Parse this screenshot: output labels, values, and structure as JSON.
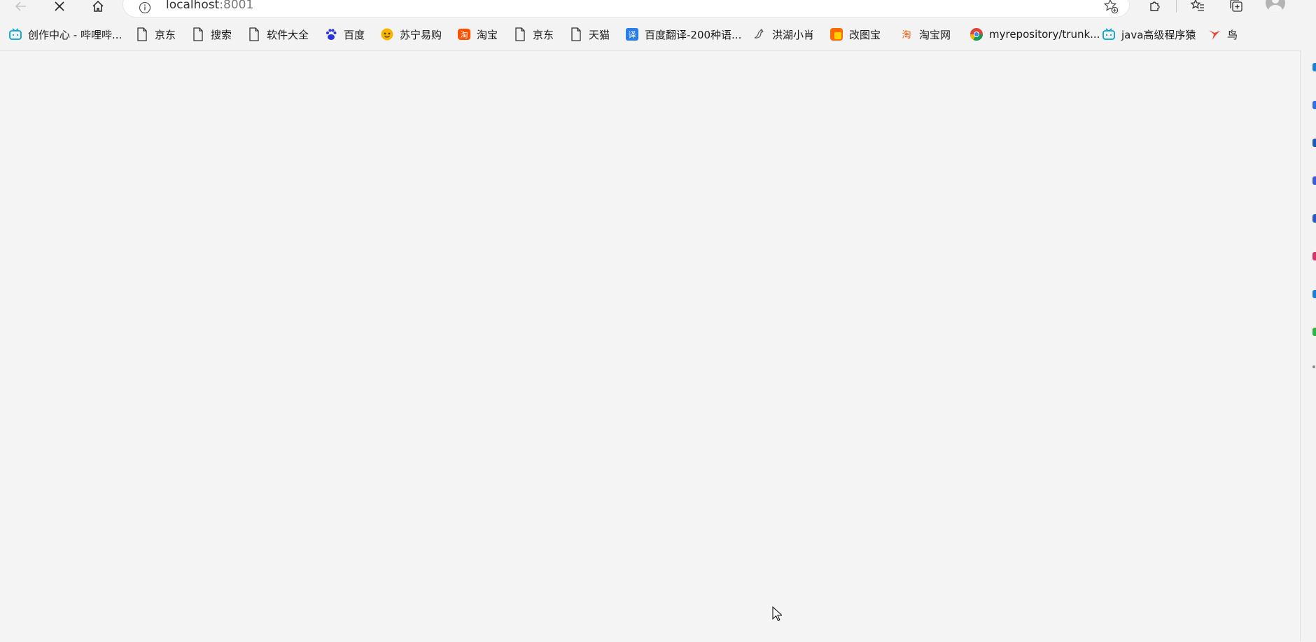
{
  "browser": {
    "toolbar": {
      "back_icon": "back-arrow-icon",
      "stop_icon": "close-icon",
      "home_icon": "home-icon"
    },
    "address": {
      "host": "localhost",
      "port": ":8001",
      "info_icon": "info-icon"
    },
    "right_icons": [
      "favorite-add-icon",
      "extensions-icon",
      "favorites-icon",
      "collections-icon",
      "profile-avatar"
    ]
  },
  "bookmarks": [
    {
      "label": "创作中心 - 哔哩哔...",
      "icon": "bilibili-icon",
      "color": "#00a1d6"
    },
    {
      "label": "京东",
      "icon": "page-icon",
      "color": "#333333"
    },
    {
      "label": "搜索",
      "icon": "page-icon",
      "color": "#333333"
    },
    {
      "label": "软件大全",
      "icon": "page-icon",
      "color": "#333333"
    },
    {
      "label": "百度",
      "icon": "baidu-paw-icon",
      "color": "#2932e1"
    },
    {
      "label": "苏宁易购",
      "icon": "suning-icon",
      "color": "#f7b500"
    },
    {
      "label": "淘宝",
      "icon": "taobao-icon",
      "color": "#ff5000"
    },
    {
      "label": "京东",
      "icon": "page-icon",
      "color": "#333333"
    },
    {
      "label": "天猫",
      "icon": "page-icon",
      "color": "#333333"
    },
    {
      "label": "百度翻译-200种语...",
      "icon": "translate-icon",
      "color": "#2b7de9"
    },
    {
      "label": "洪湖小肖",
      "icon": "bird-icon",
      "color": "#666666"
    },
    {
      "label": "改图宝",
      "icon": "gaitubao-icon",
      "color": "#ff6a00"
    },
    {
      "label": "淘宝网",
      "icon": "taobao-icon",
      "color": "#ff5000"
    },
    {
      "label": "myrepository/trunk...",
      "icon": "chrome-icon",
      "color": "#db4437"
    },
    {
      "label": "java高级程序猿",
      "icon": "bilibili-icon",
      "color": "#00a1d6"
    },
    {
      "label": "鸟",
      "icon": "bird-red-icon",
      "color": "#e8453c"
    }
  ],
  "page": {
    "background": "#f4f4f4"
  }
}
